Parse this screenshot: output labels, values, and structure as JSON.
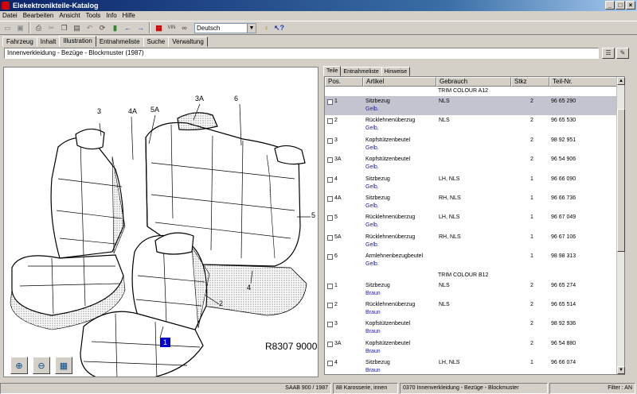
{
  "window": {
    "title": "Elekektronikteile-Katalog"
  },
  "menu": [
    "Datei",
    "Bearbeiten",
    "Ansicht",
    "Tools",
    "Info",
    "Hilfe"
  ],
  "toolbar": {
    "language": "Deutsch",
    "vin_label": "VIN"
  },
  "tabs": [
    "Fahrzeug",
    "Inhalt",
    "Illustration",
    "Entnahmeliste",
    "Suche",
    "Verwaltung"
  ],
  "breadcrumb": "Innenverkleidung - Bezüge - Blockmuster  (1987)",
  "illustration": {
    "code": "R8307 9000",
    "selected_callout": "1",
    "callouts": [
      "3",
      "4A",
      "5A",
      "3A",
      "6",
      "5",
      "4",
      "2"
    ]
  },
  "right_tabs": [
    "Teile",
    "Entnahmeliste",
    "Hinweise"
  ],
  "table": {
    "headers": [
      "Pos.",
      "Artikel",
      "Gebrauch",
      "Stkz",
      "Teil-Nr."
    ],
    "groups": [
      {
        "title": "TRIM COLOUR A12",
        "rows": [
          {
            "pos": "1",
            "artikel": "Sitzbezug",
            "color": "Gelb.",
            "gebrauch": "NLS",
            "stkz": "2",
            "teilnr": "96 65 290"
          },
          {
            "pos": "2",
            "artikel": "Rücklehnenüberzug",
            "color": "Gelb.",
            "gebrauch": "NLS",
            "stkz": "2",
            "teilnr": "96 65 530"
          },
          {
            "pos": "3",
            "artikel": "Kopfstützenbeutel",
            "color": "Gelb.",
            "gebrauch": "",
            "stkz": "2",
            "teilnr": "98 92 951"
          },
          {
            "pos": "3A",
            "artikel": "Kopfstützenbeutel",
            "color": "Gelb.",
            "gebrauch": "",
            "stkz": "2",
            "teilnr": "96 54 906"
          },
          {
            "pos": "4",
            "artikel": "Sitzbezug",
            "color": "Gelb.",
            "gebrauch": "LH, NLS",
            "stkz": "1",
            "teilnr": "96 66 090"
          },
          {
            "pos": "4A",
            "artikel": "Sitzbezug",
            "color": "Gelb.",
            "gebrauch": "RH, NLS",
            "stkz": "1",
            "teilnr": "96 66 736"
          },
          {
            "pos": "5",
            "artikel": "Rücklehnenüberzug",
            "color": "Gelb.",
            "gebrauch": "LH, NLS",
            "stkz": "1",
            "teilnr": "96 67 049"
          },
          {
            "pos": "5A",
            "artikel": "Rücklehnenüberzug",
            "color": "Gelb.",
            "gebrauch": "RH, NLS",
            "stkz": "1",
            "teilnr": "96 67 106"
          },
          {
            "pos": "6",
            "artikel": "Armlehnenbezugbeutel",
            "color": "Gelb.",
            "gebrauch": "",
            "stkz": "1",
            "teilnr": "98 98 313"
          }
        ]
      },
      {
        "title": "TRIM COLOUR B12",
        "rows": [
          {
            "pos": "1",
            "artikel": "Sitzbezug",
            "color": "Braun",
            "gebrauch": "NLS",
            "stkz": "2",
            "teilnr": "96 65 274"
          },
          {
            "pos": "2",
            "artikel": "Rücklehnenüberzug",
            "color": "Braun",
            "gebrauch": "NLS",
            "stkz": "2",
            "teilnr": "96 65 514"
          },
          {
            "pos": "3",
            "artikel": "Kopfstützenbeutel",
            "color": "Braun",
            "gebrauch": "",
            "stkz": "2",
            "teilnr": "98 92 936"
          },
          {
            "pos": "3A",
            "artikel": "Kopfstützenbeutel",
            "color": "Braun",
            "gebrauch": "",
            "stkz": "2",
            "teilnr": "96 54 880"
          },
          {
            "pos": "4",
            "artikel": "Sitzbezug",
            "color": "Braun",
            "gebrauch": "LH, NLS",
            "stkz": "1",
            "teilnr": "96 66 074"
          }
        ]
      }
    ]
  },
  "status": [
    "SAAB 900 / 1987",
    "88 Karosserie, innen",
    "0370 Innenverkleidung - Bezüge - Blockmuster",
    "Filter : AN"
  ]
}
